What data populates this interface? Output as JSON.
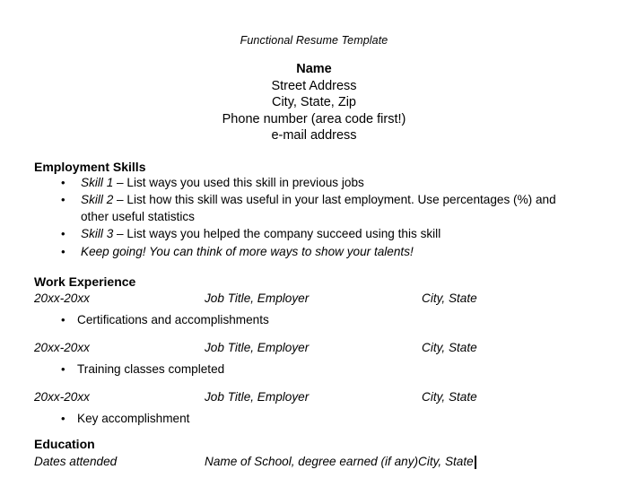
{
  "document": {
    "title": "Functional Resume Template"
  },
  "contact": {
    "lines": [
      {
        "text": "Name",
        "bold": true
      },
      {
        "text": "Street Address",
        "bold": false
      },
      {
        "text": "City, State, Zip",
        "bold": false
      },
      {
        "text": "Phone number (area code first!)",
        "bold": false
      },
      {
        "text": "e-mail address",
        "bold": false
      }
    ]
  },
  "sections": {
    "skills": {
      "heading": "Employment Skills",
      "bullet_glyph": "•",
      "items": [
        {
          "label": "Skill 1",
          "body": " – List ways you used this skill in previous jobs",
          "all_italic": false
        },
        {
          "label": "Skill 2",
          "body": " – List how this skill was useful in your last employment. Use percentages (%) and other useful statistics",
          "all_italic": false
        },
        {
          "label": "Skill 3",
          "body": " – List ways you helped the company succeed using this skill",
          "all_italic": false
        },
        {
          "label": "",
          "body": "Keep going! You can think of more ways to show your talents!",
          "all_italic": true
        }
      ]
    },
    "work": {
      "heading": "Work Experience",
      "bullet_glyph": "•",
      "entries": [
        {
          "dates": "20xx-20xx",
          "title": "Job Title,  Employer",
          "location": "City, State",
          "bullet": "Certifications and accomplishments"
        },
        {
          "dates": "20xx-20xx",
          "title": "Job Title,  Employer",
          "location": "City, State",
          "bullet": "Training classes completed"
        },
        {
          "dates": "20xx-20xx",
          "title": "Job Title,  Employer",
          "location": "City, State",
          "bullet": "Key accomplishment"
        }
      ]
    },
    "education": {
      "heading": "Education",
      "dates": "Dates attended",
      "school": "Name of School, degree earned (if any)",
      "location": "City, State"
    }
  },
  "colors": {
    "page_background": "#ffffff",
    "text": "#000000",
    "caret": "#000000"
  }
}
